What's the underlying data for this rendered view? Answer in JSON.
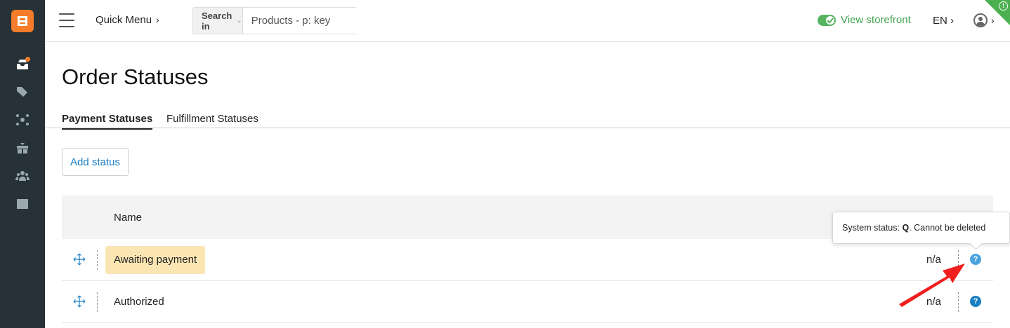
{
  "header": {
    "quick_menu_label": "Quick Menu",
    "search_in_label": "Search in",
    "search_placeholder": "Products - p: key",
    "storefront_label": "View storefront",
    "language": "EN"
  },
  "page": {
    "title": "Order Statuses",
    "tabs": [
      {
        "label": "Payment Statuses"
      },
      {
        "label": "Fulfillment Statuses"
      }
    ],
    "add_button_label": "Add status"
  },
  "table": {
    "column_name": "Name",
    "rows": [
      {
        "name": "Awaiting payment",
        "value": "n/a"
      },
      {
        "name": "Authorized",
        "value": "n/a"
      }
    ]
  },
  "tooltip": {
    "prefix": "System status: ",
    "code": "Q",
    "suffix": ". Cannot be deleted"
  },
  "colors": {
    "sidebar": "#263238",
    "brand": "#f57c29",
    "link": "#1a7ec2",
    "success": "#3fa34d",
    "highlight": "#fbe6b3"
  }
}
